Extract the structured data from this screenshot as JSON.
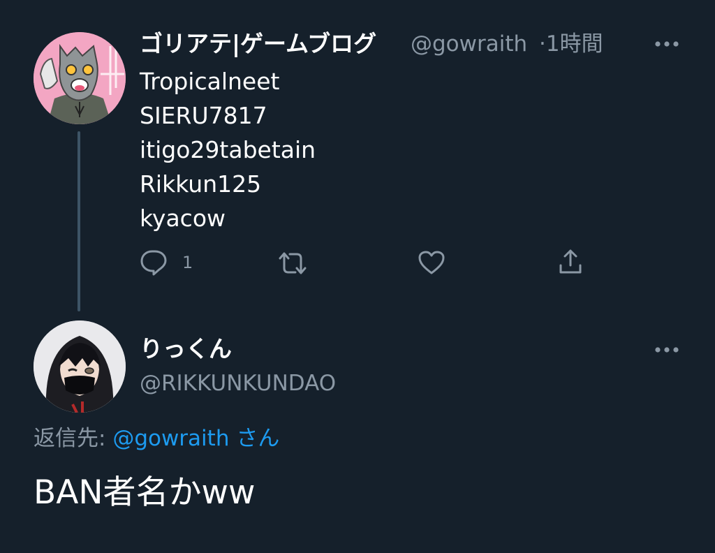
{
  "tweet": {
    "display_name": "ゴリアテ|ゲームブログ",
    "handle": "@gowraith",
    "time": "·1時間",
    "lines": [
      "Tropicalneet",
      "SIERU7817",
      "itigo29tabetain",
      "Rikkun125",
      "kyacow"
    ],
    "reply_count": "1",
    "icons": {
      "more": "more-horizontal-icon",
      "reply": "reply-bubble-icon",
      "retweet": "retweet-icon",
      "like": "heart-icon",
      "share": "share-upload-icon"
    }
  },
  "reply": {
    "display_name": "りっくん",
    "handle": "@RIKKUNKUNDAO",
    "reply_to_label": "返信先:",
    "reply_to_handle": "@gowraith",
    "reply_to_suffix": "さん",
    "text": "BAN者名かww"
  },
  "colors": {
    "background": "#15202b",
    "secondary_text": "#8b98a5",
    "link": "#1d9bf0",
    "thread_line": "#3d5466"
  }
}
